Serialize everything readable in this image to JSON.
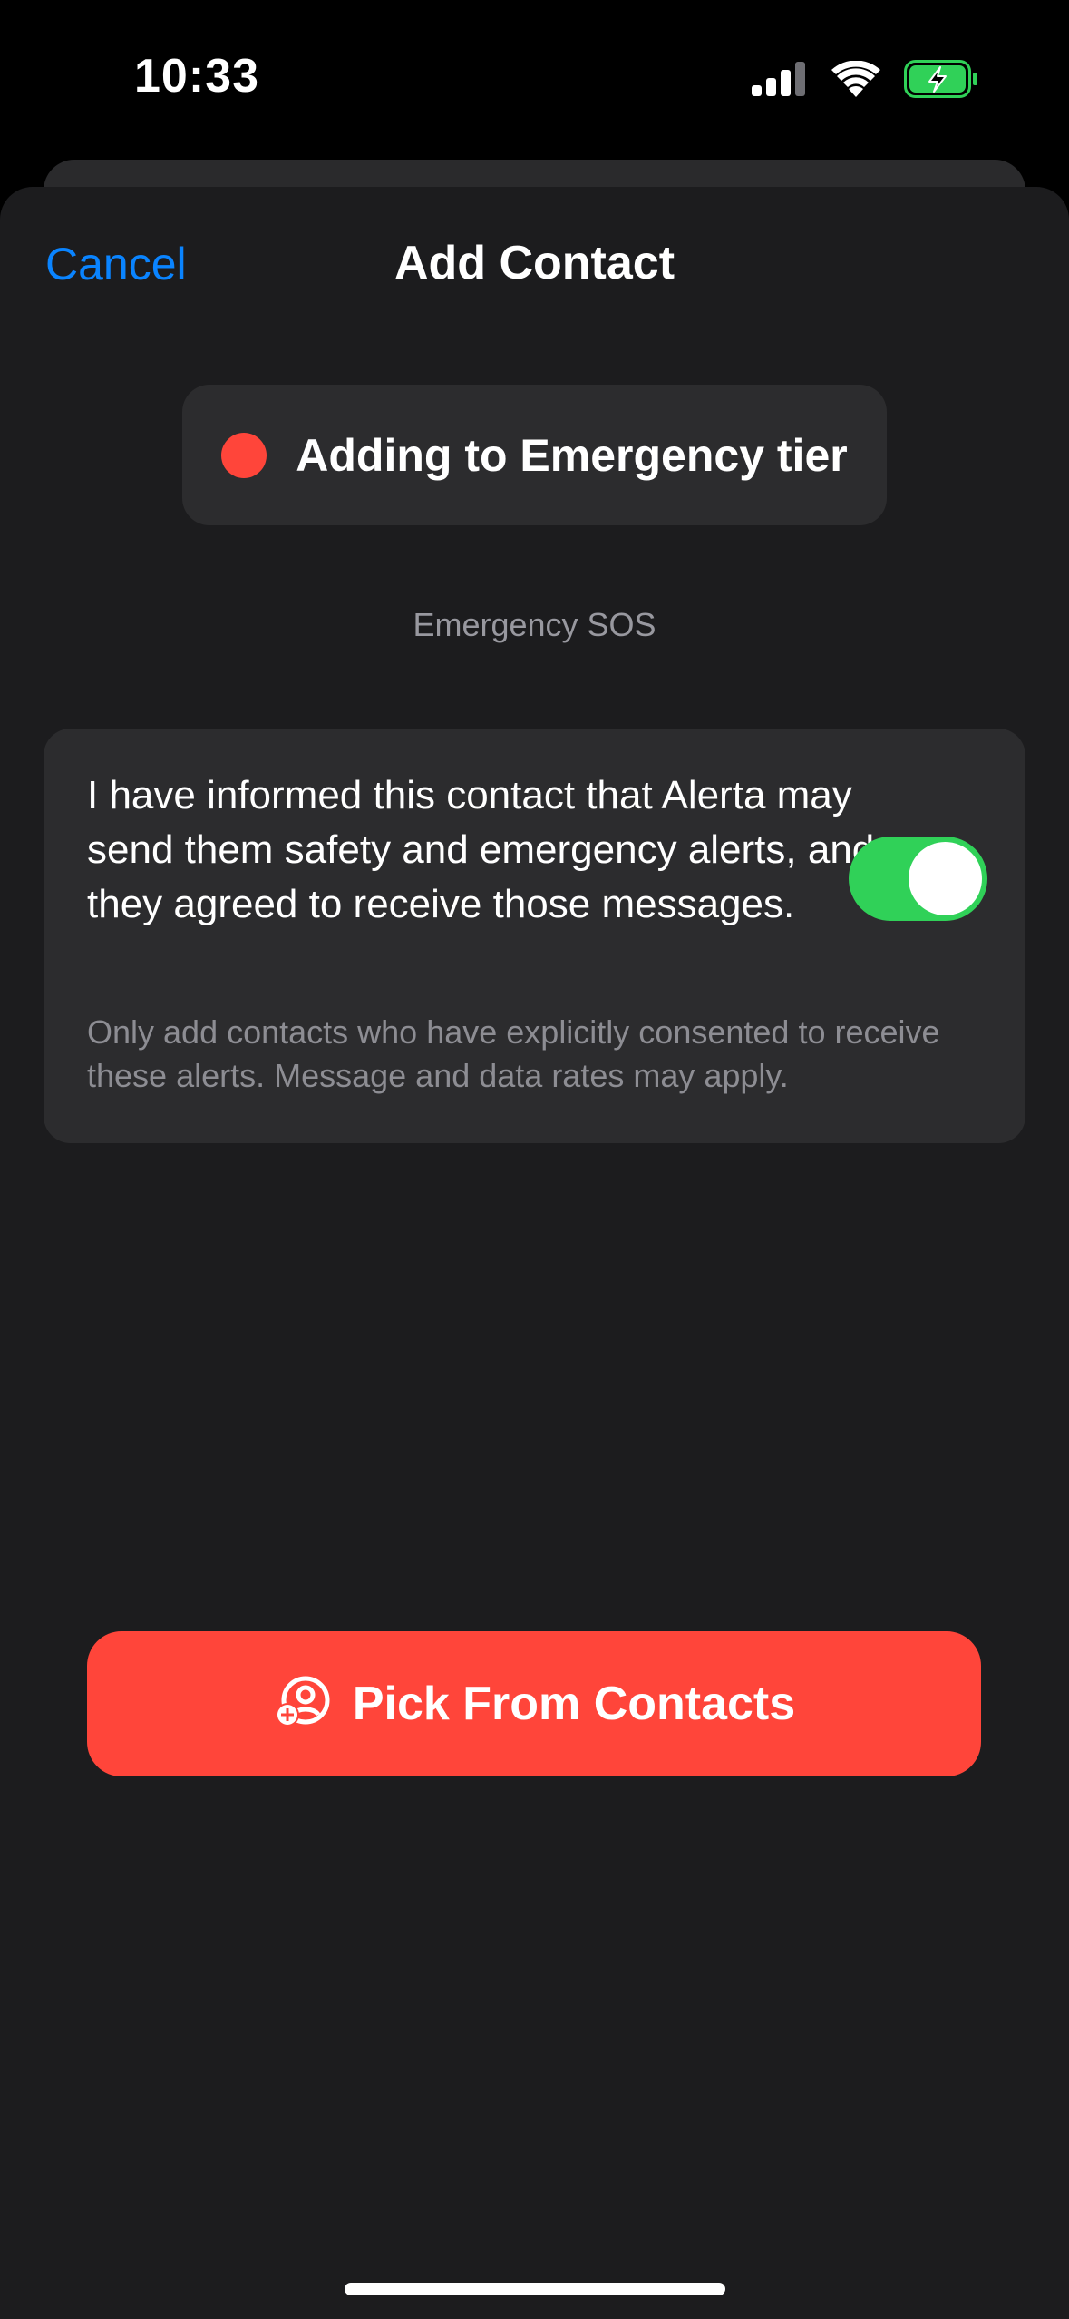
{
  "status_bar": {
    "time": "10:33",
    "icons": [
      "cellular-signal-icon",
      "wifi-icon",
      "battery-charging-icon"
    ]
  },
  "nav": {
    "cancel_label": "Cancel",
    "title": "Add Contact"
  },
  "tier": {
    "label": "Adding to Emergency tier",
    "dot_color": "#ff453a"
  },
  "section": {
    "label": "Emergency SOS"
  },
  "consent": {
    "text": "I have informed this contact that Alerta may send them safety and emergency alerts, and they agreed to receive those messages.",
    "note": "Only add contacts who have explicitly consented to receive these alerts. Message and data rates may apply.",
    "toggle_on": true
  },
  "pick_button": {
    "label": "Pick From Contacts",
    "icon": "add-person-circle-icon"
  },
  "colors": {
    "accent_blue": "#0a84ff",
    "toggle_green": "#30d158",
    "button_red": "#ff453a",
    "sheet_background": "#1c1c1e",
    "card_background": "#2c2c2e",
    "battery_green": "#30d158"
  }
}
